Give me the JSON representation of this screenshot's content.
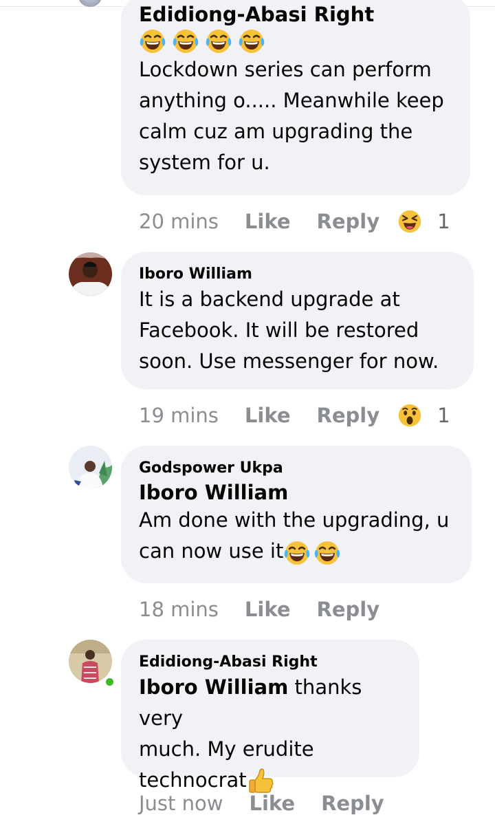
{
  "comments": [
    {
      "author": "Edidiong-Abasi Right",
      "emojis": [
        "laugh-cry",
        "laugh-cry",
        "laugh-cry",
        "laugh-cry"
      ],
      "lines": [
        "Lockdown series can perform",
        "anything o..... Meanwhile keep",
        "calm cuz am upgrading the",
        "system for u."
      ],
      "time": "20 mins",
      "like": "Like",
      "reply": "Reply",
      "reaction": "haha",
      "reaction_count": "1"
    },
    {
      "author": "Iboro William",
      "lines": [
        "It is a backend upgrade at",
        "Facebook. It will be restored",
        "soon. Use messenger for now."
      ],
      "time": "19 mins",
      "like": "Like",
      "reply": "Reply",
      "reaction": "wow",
      "reaction_count": "1"
    },
    {
      "author": "Godspower Ukpa",
      "mention": "Iboro William",
      "lines": [
        "Am done with the upgrading, u",
        "can now use it"
      ],
      "trailing_emojis": [
        "laugh-cry",
        "laugh-cry"
      ],
      "time": "18 mins",
      "like": "Like",
      "reply": "Reply"
    },
    {
      "author": "Edidiong-Abasi Right",
      "mention": "Iboro William",
      "line1_rest": " thanks very",
      "line2": "much. My erudite",
      "line3": "technocrat",
      "trailing_emoji": "thumbs-up",
      "time": "Just now",
      "like": "Like",
      "reply": "Reply",
      "online": true
    }
  ],
  "colors": {
    "bubble": "#f0f2f5",
    "meta": "#8a8d91",
    "online": "#42b72a",
    "emoji": "#f7c23b"
  }
}
